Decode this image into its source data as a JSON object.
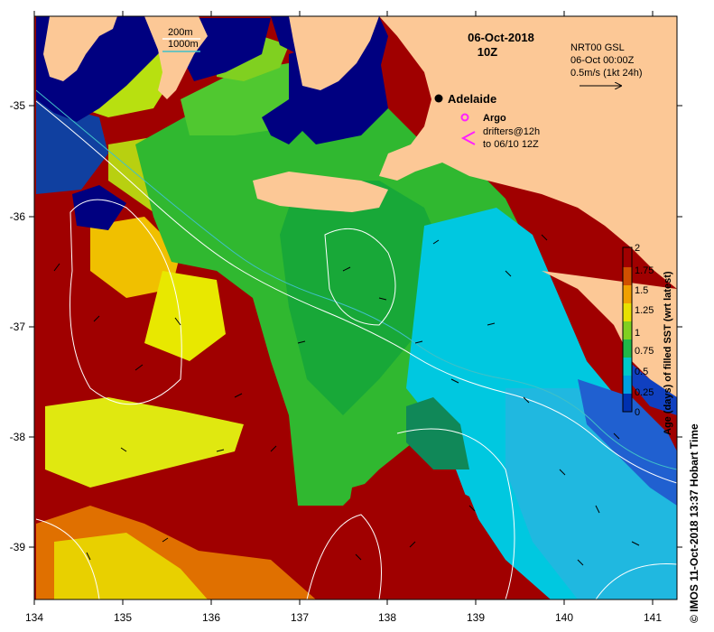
{
  "header": {
    "date": "06-Oct-2018",
    "time": "10Z"
  },
  "bathymetry_legend": {
    "contour_200": "200m",
    "contour_1000": "1000m",
    "colors": {
      "contour_200": "#ffffff",
      "contour_1000": "#40c0c8"
    }
  },
  "velocity_legend": {
    "source": "NRT00 GSL",
    "valid_time": "06-Oct 00:00Z",
    "scale": "0.5m/s (1kt 24h)"
  },
  "places": {
    "city": "Adelaide",
    "argo": "Argo",
    "drifters_line1": "drifters@12h",
    "drifters_line2": "to 06/10 12Z"
  },
  "axes": {
    "x_ticks": [
      "134",
      "135",
      "136",
      "137",
      "138",
      "139",
      "140",
      "141"
    ],
    "y_ticks": [
      "-35",
      "-36",
      "-37",
      "-38",
      "-39"
    ],
    "x_range": [
      134,
      141.3
    ],
    "y_range": [
      -39.5,
      -34.2
    ]
  },
  "colorbar": {
    "label": "Age (days) of filled SST (wrt latest)",
    "ticks": [
      "2",
      "1.75",
      "1.5",
      "1.25",
      "1",
      "0.75",
      "0.5",
      "0.25",
      "0"
    ],
    "range": [
      0,
      2
    ],
    "colors": [
      "#00008c",
      "#0050d0",
      "#00b8e8",
      "#00d8d0",
      "#20b848",
      "#60d020",
      "#e0f010",
      "#f8b000",
      "#e06000",
      "#a00000"
    ]
  },
  "land_color": "#fcc896",
  "credit": "©  IMOS 11-Oct-2018 13:37 Hobart Time"
}
